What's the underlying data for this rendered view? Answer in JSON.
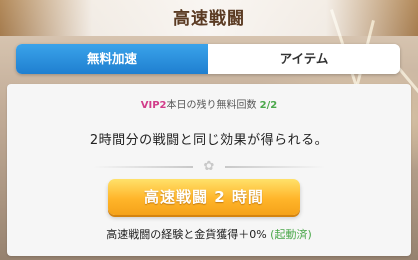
{
  "header": {
    "title": "高速戦闘"
  },
  "tabs": [
    {
      "label": "無料加速"
    },
    {
      "label": "アイテム"
    }
  ],
  "vip": {
    "level": "VIP2",
    "text": "本日の残り無料回数",
    "count": "2/2"
  },
  "description": "2時間分の戦闘と同じ効果が得られる。",
  "button": {
    "label": "高速戦闘 2 時間"
  },
  "bonus": {
    "text": "高速戦闘の経験と金貨獲得＋0%",
    "status": "(起動済)"
  },
  "colors": {
    "tab_active": "#1f7fd0",
    "button": "#ffb52a",
    "vip": "#d23c8a",
    "count": "#4aa84a"
  }
}
